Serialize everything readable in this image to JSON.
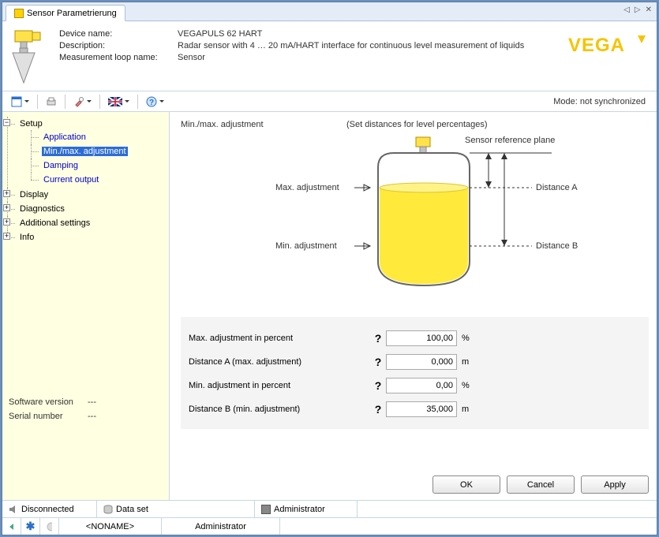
{
  "tab": {
    "title": "Sensor Parametrierung"
  },
  "header": {
    "labels": {
      "device_name": "Device name:",
      "description": "Description:",
      "loop_name": "Measurement loop name:"
    },
    "device_name": "VEGAPULS 62 HART",
    "description": "Radar sensor with 4 … 20 mA/HART interface for continuous level measurement of liquids",
    "loop_name": "Sensor",
    "logo_text": "VEGA"
  },
  "toolbar": {
    "mode": "Mode: not synchronized"
  },
  "tree": {
    "root": "Setup",
    "setup_children": [
      "Application",
      "Min./max. adjustment",
      "Damping",
      "Current output"
    ],
    "selected_index": 1,
    "collapsed": [
      "Display",
      "Diagnostics",
      "Additional settings",
      "Info"
    ],
    "bottom": {
      "sw_label": "Software version",
      "sw_value": "---",
      "sn_label": "Serial number",
      "sn_value": "---"
    }
  },
  "content": {
    "title": "Min./max. adjustment",
    "hint": "(Set distances for level percentages)",
    "diagram": {
      "ref_plane": "Sensor reference plane",
      "max_adj": "Max. adjustment",
      "min_adj": "Min. adjustment",
      "dist_a": "Distance A",
      "dist_b": "Distance B"
    },
    "fields": [
      {
        "label": "Max. adjustment in percent",
        "value": "100,00",
        "unit": "%"
      },
      {
        "label": "Distance A (max. adjustment)",
        "value": "0,000",
        "unit": "m"
      },
      {
        "label": "Min. adjustment in percent",
        "value": "0,00",
        "unit": "%"
      },
      {
        "label": "Distance B (min. adjustment)",
        "value": "35,000",
        "unit": "m"
      }
    ],
    "buttons": {
      "ok": "OK",
      "cancel": "Cancel",
      "apply": "Apply"
    }
  },
  "status": {
    "connection": "Disconnected",
    "dataset": "Data set",
    "role": "Administrator",
    "noname": "<NONAME>",
    "role2": "Administrator"
  }
}
